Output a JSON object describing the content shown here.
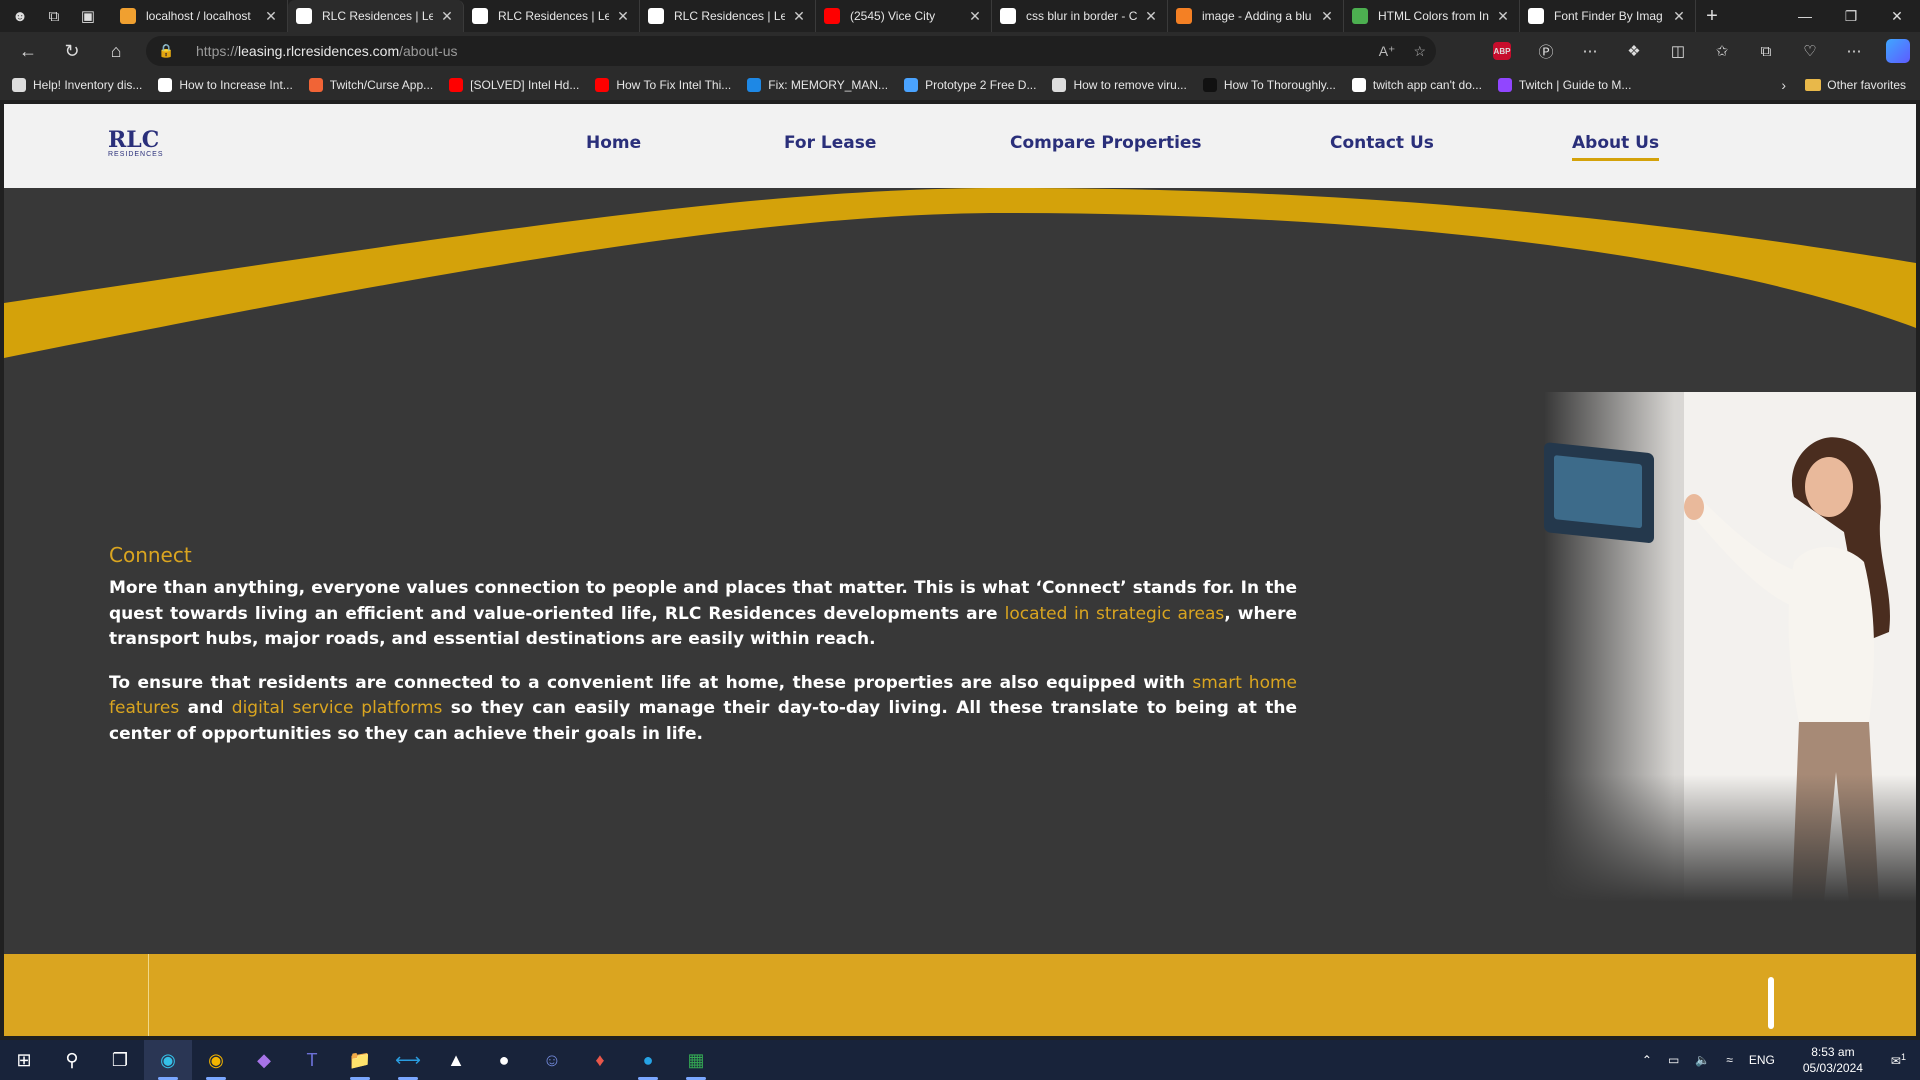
{
  "browser": {
    "tabs": [
      {
        "title": "localhost / localhost",
        "icon": "phpmyadmin-icon",
        "color": "#f0a030"
      },
      {
        "title": "RLC Residences | Lea",
        "icon": "rlc-favicon-icon",
        "color": "#ffffff",
        "active": true
      },
      {
        "title": "RLC Residences | Lea",
        "icon": "rlc-favicon-icon",
        "color": "#ffffff"
      },
      {
        "title": "RLC Residences | Lea",
        "icon": "rlc-favicon-icon",
        "color": "#ffffff"
      },
      {
        "title": "(2545) Vice City",
        "icon": "youtube-icon",
        "color": "#ff0000"
      },
      {
        "title": "css blur in border - C",
        "icon": "google-icon",
        "color": "#ffffff"
      },
      {
        "title": "image - Adding a blu",
        "icon": "stackoverflow-icon",
        "color": "#f48024"
      },
      {
        "title": "HTML Colors from In",
        "icon": "colors-icon",
        "color": "#4caf50"
      },
      {
        "title": "Font Finder By Imag",
        "icon": "fontfinder-icon",
        "color": "#ffffff"
      }
    ],
    "url_prefix": "https://",
    "url_host": "leasing.rlcresidences.com",
    "url_path": "/about-us",
    "bookmarks": [
      {
        "label": "Help! Inventory dis...",
        "icon": "page-icon",
        "color": "#dddddd"
      },
      {
        "label": "How to Increase Int...",
        "icon": "site-icon",
        "color": "#ffffff"
      },
      {
        "label": "Twitch/Curse App...",
        "icon": "curseforge-icon",
        "color": "#f16436"
      },
      {
        "label": "[SOLVED] Intel Hd...",
        "icon": "youtube-icon",
        "color": "#ff0000"
      },
      {
        "label": "How To Fix Intel Thi...",
        "icon": "youtube-icon",
        "color": "#ff0000"
      },
      {
        "label": "Fix: MEMORY_MAN...",
        "icon": "w-icon",
        "color": "#1e88e5"
      },
      {
        "label": "Prototype 2 Free D...",
        "icon": "gamepad-icon",
        "color": "#4aa3ff"
      },
      {
        "label": "How to remove viru...",
        "icon": "page-icon",
        "color": "#dddddd"
      },
      {
        "label": "How To Thoroughly...",
        "icon": "site-icon",
        "color": "#111111"
      },
      {
        "label": "twitch app can't do...",
        "icon": "google-icon",
        "color": "#ffffff"
      },
      {
        "label": "Twitch | Guide to M...",
        "icon": "twitch-icon",
        "color": "#9146ff"
      }
    ],
    "other_favorites": "Other favorites"
  },
  "site": {
    "logo_main": "RLC",
    "logo_sub": "RESIDENCES",
    "nav": [
      {
        "label": "Home"
      },
      {
        "label": "For Lease"
      },
      {
        "label": "Compare Properties"
      },
      {
        "label": "Contact Us"
      },
      {
        "label": "About Us",
        "active": true
      }
    ],
    "section_title": "Connect",
    "p1_a": "More than anything, everyone values connection to people and places that matter. This is what ‘Connect’ stands for. In the quest towards living an efficient and value-oriented life, RLC Residences developments are ",
    "p1_link": "located in strategic areas",
    "p1_b": ", where transport hubs, major roads, and essential destinations are easily within reach.",
    "p2_a": "To ensure that residents are connected to a convenient life at home, these properties are also equipped with ",
    "p2_link1": "smart home features",
    "p2_b": " and ",
    "p2_link2": "digital service platforms",
    "p2_c": " so they can easily manage their day-to-day living. All these translate to being at the center of opportunities so they can achieve their goals in life.",
    "colors": {
      "navy": "#2a2f7a",
      "gold": "#daa520",
      "dark_bg": "#383838",
      "header_bg": "#f2f2f2"
    }
  },
  "taskbar": {
    "apps": [
      "windows-start-icon",
      "search-icon",
      "task-view-icon",
      "edge-icon",
      "chrome-icon",
      "visual-studio-icon",
      "teams-icon",
      "file-explorer-icon",
      "vscode-icon",
      "shield-app-icon",
      "steam-icon",
      "discord-icon",
      "game-icon",
      "browser-blue-icon",
      "sheets-icon"
    ],
    "lang": "ENG",
    "time": "8:53 am",
    "date": "05/03/2024",
    "notifications": "1"
  }
}
